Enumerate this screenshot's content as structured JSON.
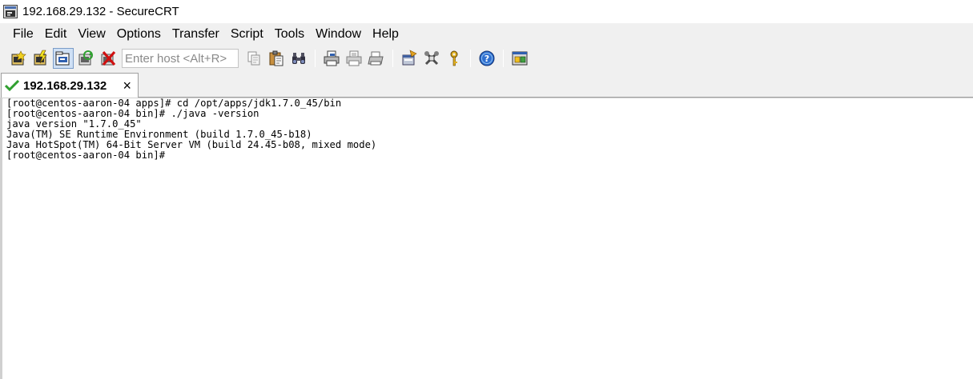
{
  "window": {
    "title": "192.168.29.132 - SecureCRT"
  },
  "menu": [
    "File",
    "Edit",
    "View",
    "Options",
    "Transfer",
    "Script",
    "Tools",
    "Window",
    "Help"
  ],
  "toolbar": {
    "host_placeholder": "Enter host <Alt+R>",
    "icons_left": [
      "connect-icon",
      "quick-connect-icon",
      "connect-in-tab-icon",
      "reconnect-icon",
      "disconnect-icon"
    ],
    "icons_right": [
      "copy-icon",
      "paste-icon",
      "find-icon",
      "print-icon",
      "print-selection-icon",
      "print-setup-icon",
      "session-options-icon",
      "global-options-icon",
      "keymap-icon",
      "help-icon",
      "sftp-icon"
    ]
  },
  "tabs": [
    {
      "label": "192.168.29.132",
      "status": "connected",
      "close": "×"
    }
  ],
  "terminal": {
    "lines": [
      "[root@centos-aaron-04 apps]# cd /opt/apps/jdk1.7.0_45/bin",
      "[root@centos-aaron-04 bin]# ./java -version",
      "java version \"1.7.0_45\"",
      "Java(TM) SE Runtime Environment (build 1.7.0_45-b18)",
      "Java HotSpot(TM) 64-Bit Server VM (build 24.45-b08, mixed mode)",
      "[root@centos-aaron-04 bin]#"
    ]
  }
}
